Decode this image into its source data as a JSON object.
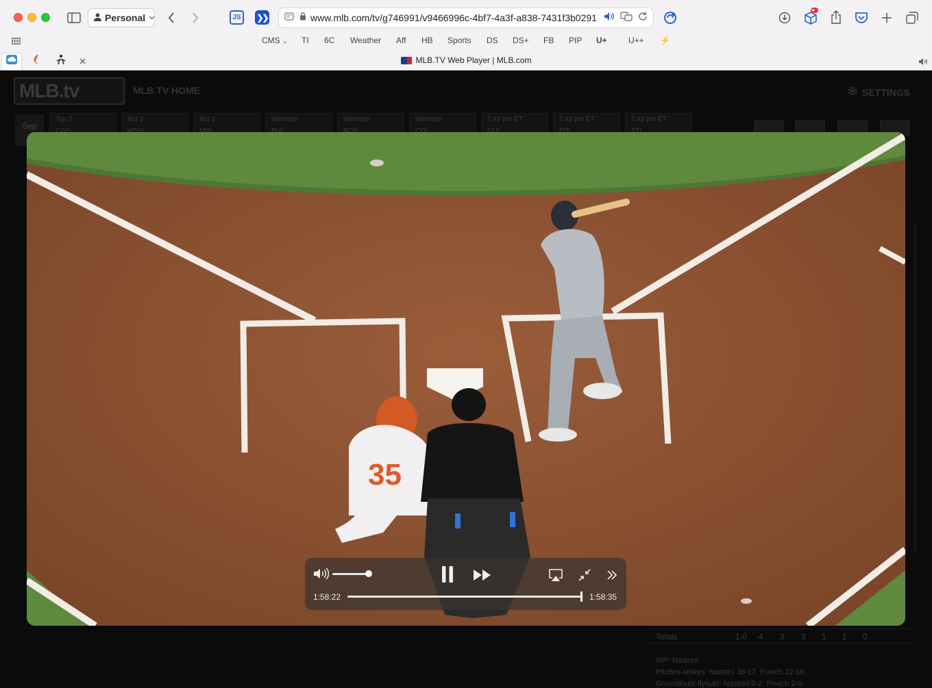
{
  "browser": {
    "profile_label": "Personal",
    "url": "www.mlb.com/tv/g746991/v9466996c-4bf7-4a3f-a838-7431f3b0291",
    "extension_js_label": "JS",
    "bookmarks": [
      {
        "label": "CMS"
      },
      {
        "label": "TI"
      },
      {
        "label": "6C"
      },
      {
        "label": "Weather"
      },
      {
        "label": "Aff"
      },
      {
        "label": "HB"
      },
      {
        "label": "Sports"
      },
      {
        "label": "DS"
      },
      {
        "label": "DS+"
      },
      {
        "label": "FB"
      },
      {
        "label": "PIP"
      },
      {
        "label": "U+"
      },
      {
        "label": "U++"
      }
    ],
    "active_tab_title": "MLB.TV Web Player | MLB.com"
  },
  "page": {
    "logo_text": "MLB.tv",
    "home_link": "MLB.TV HOME",
    "settings_label": "SETTINGS",
    "date_label": "Sep",
    "games": [
      {
        "status": "Top 2",
        "team": "CWS"
      },
      {
        "status": "Bot 2",
        "team": "WSH",
        "score": "0"
      },
      {
        "status": "Bot 1",
        "team": "MIN",
        "score": "0"
      },
      {
        "status": "Warmup",
        "team": "PHI",
        "score": "0"
      },
      {
        "status": "Warmup",
        "team": "BOS",
        "score": "0"
      },
      {
        "status": "Warmup",
        "team": "COL",
        "score": "0"
      },
      {
        "status": "7:40 pm ET",
        "team": "CLE"
      },
      {
        "status": "7:40 pm ET",
        "team": "PIT"
      },
      {
        "status": "7:40 pm ET",
        "team": "STL"
      }
    ],
    "totals_label": "Totals",
    "totals_values": [
      "1.0",
      "4",
      "3",
      "3",
      "1",
      "1",
      "0"
    ],
    "notes": [
      "WP: Nastrini.",
      "Pitches-strikes: Nastrini 36-17, Povich 22-16.",
      "Groundouts-flyouts: Nastrini 0-2, Povich 2-0."
    ]
  },
  "player": {
    "current_time": "1:58:22",
    "remaining_time": "1:58:35",
    "progress": 0.99,
    "volume": 0.95
  },
  "colors": {
    "chrome_bg": "#f3f1f3",
    "accent_blue": "#1e4fd0",
    "dirt": "#8a5334",
    "grass": "#5f8a3e"
  }
}
